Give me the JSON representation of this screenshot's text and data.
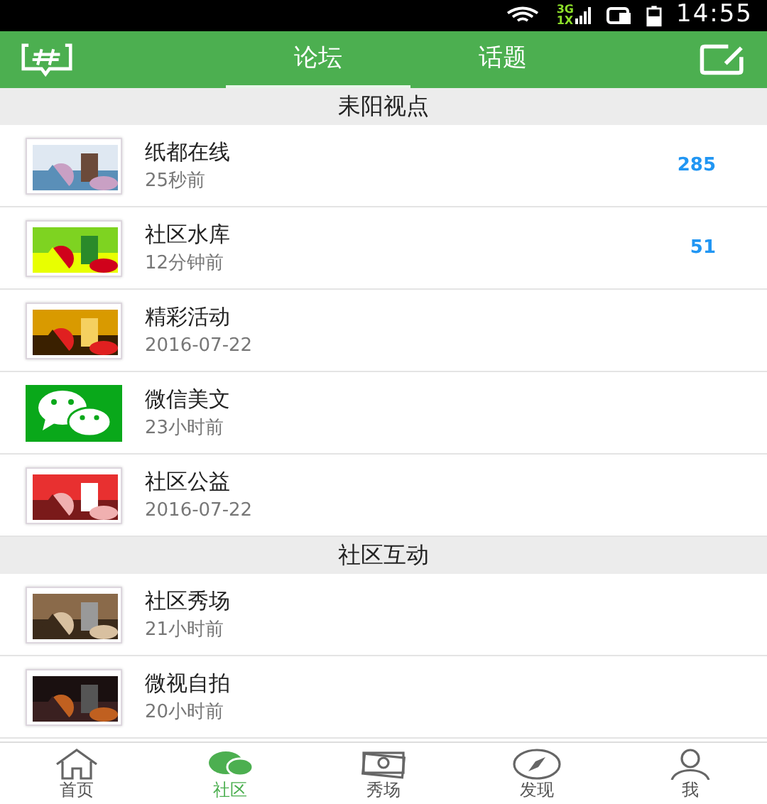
{
  "status_bar": {
    "network_top": "3G",
    "network_bottom": "1X",
    "time": "14:55"
  },
  "tabs": [
    {
      "label": "论坛",
      "selected": true
    },
    {
      "label": "话题",
      "selected": false
    }
  ],
  "sections": [
    {
      "title": "耒阳视点",
      "items": [
        {
          "title": "纸都在线",
          "time": "25秒前",
          "count": "285",
          "kind": "picture"
        },
        {
          "title": "社区水库",
          "time": "12分钟前",
          "count": "51",
          "kind": "picture"
        },
        {
          "title": "精彩活动",
          "time": "2016-07-22",
          "kind": "picture"
        },
        {
          "title": "微信美文",
          "time": "23小时前",
          "kind": "logo"
        },
        {
          "title": "社区公益",
          "time": "2016-07-22",
          "kind": "picture"
        }
      ]
    },
    {
      "title": "社区互动",
      "items": [
        {
          "title": "社区秀场",
          "time": "21小时前",
          "kind": "picture"
        },
        {
          "title": "微视自拍",
          "time": "20小时前",
          "kind": "picture"
        }
      ]
    }
  ],
  "nav": [
    {
      "label": "首页",
      "selected": false
    },
    {
      "label": "社区",
      "selected": true
    },
    {
      "label": "秀场",
      "selected": false
    },
    {
      "label": "发现",
      "selected": false
    },
    {
      "label": "我",
      "selected": false
    }
  ]
}
